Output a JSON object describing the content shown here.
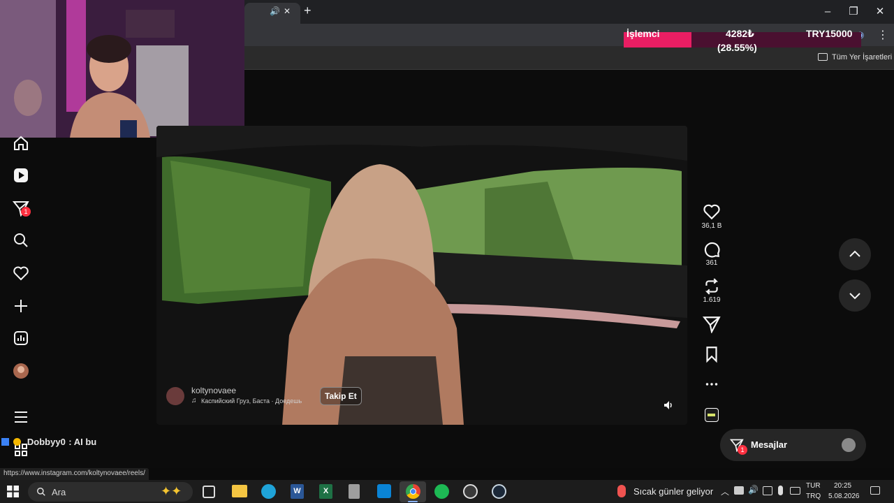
{
  "browser": {
    "tab_close": "✕",
    "new_tab": "+",
    "bookmarks_label": "Tüm Yer İşaretleri"
  },
  "donation": {
    "label": "İşlemci",
    "amount": "4282₺",
    "percent": "(28.55%)",
    "goal": "TRY15000",
    "progress": 0.2855
  },
  "chat": {
    "user": "Dobbyy0",
    "message": ": AI bu"
  },
  "sidebar": {
    "items": [
      {
        "icon": "home-icon"
      },
      {
        "icon": "reels-icon"
      },
      {
        "icon": "direct-icon",
        "badge": "1"
      },
      {
        "icon": "search-icon"
      },
      {
        "icon": "heart-icon"
      },
      {
        "icon": "plus-icon"
      },
      {
        "icon": "dashboard-icon"
      },
      {
        "icon": "profile-avatar"
      },
      {
        "icon": "menu-icon"
      },
      {
        "icon": "apps-icon"
      }
    ]
  },
  "reel": {
    "username": "koltynovaee",
    "audio": "Каспийский Груз, Баста · Доедешь",
    "follow": "Takip Et",
    "likes": "36,1 B",
    "comments": "361",
    "reposts": "1.619"
  },
  "messages": {
    "label": "Mesajlar",
    "badge": "1"
  },
  "status_url": "https://www.instagram.com/koltynovaee/reels/",
  "taskbar": {
    "search_placeholder": "Ara",
    "weather": "Sıcak günler geliyor",
    "lang_top": "TUR",
    "lang_bottom": "TRQ",
    "time": "20:25",
    "date": "5.08.2026"
  },
  "colors": {
    "accent_pink": "#e91e63",
    "badge_red": "#ff3040"
  }
}
